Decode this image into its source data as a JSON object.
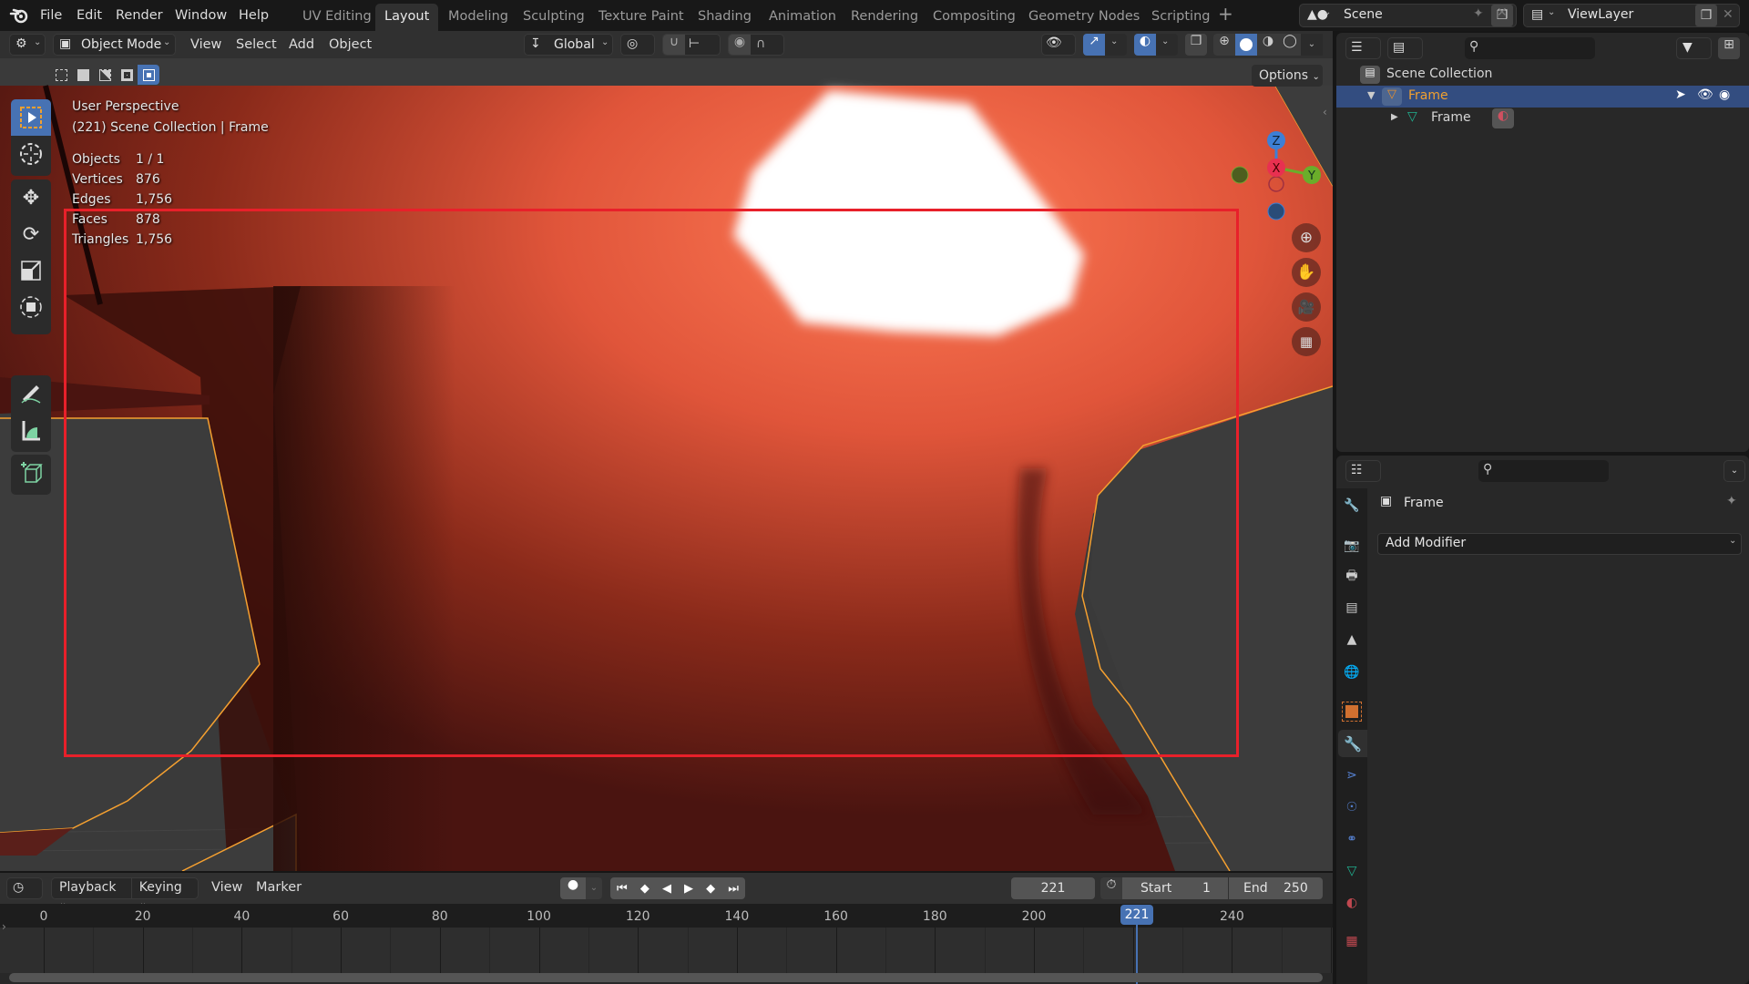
{
  "topbar": {
    "menus": [
      "File",
      "Edit",
      "Render",
      "Window",
      "Help"
    ],
    "workspaces": [
      "UV Editing",
      "Layout",
      "Modeling",
      "Sculpting",
      "Texture Paint",
      "Shading",
      "Animation",
      "Rendering",
      "Compositing",
      "Geometry Nodes",
      "Scripting"
    ],
    "active_workspace": "Layout",
    "add_workspace": "+",
    "scene": "Scene",
    "view_layer": "ViewLayer"
  },
  "viewport_header": {
    "mode": "Object Mode",
    "menus": [
      "View",
      "Select",
      "Add",
      "Object"
    ],
    "transform_orientation": "Global",
    "options_label": "Options"
  },
  "viewport": {
    "view_name": "User Perspective",
    "collection_info": "(221) Scene Collection | Frame",
    "stats": [
      {
        "label": "Objects",
        "value": "1 / 1"
      },
      {
        "label": "Vertices",
        "value": "876"
      },
      {
        "label": "Edges",
        "value": "1,756"
      },
      {
        "label": "Faces",
        "value": "878"
      },
      {
        "label": "Triangles",
        "value": "1,756"
      }
    ],
    "gizmo_axes": {
      "z": "Z",
      "x": "X",
      "y": "Y"
    },
    "colors": {
      "highlight_rect": "#e8202a",
      "selection_outline": "#f5a030",
      "object": "#c84a30"
    }
  },
  "outliner": {
    "root": "Scene Collection",
    "items": [
      {
        "name": "Frame",
        "type": "object",
        "selected": true
      },
      {
        "name": "Frame",
        "type": "mesh-data"
      }
    ]
  },
  "properties": {
    "object_name": "Frame",
    "add_modifier_label": "Add Modifier",
    "tabs": [
      "tool",
      "render",
      "output",
      "view-layer",
      "scene",
      "world",
      "object",
      "modifiers",
      "particles",
      "physics",
      "constraints",
      "data",
      "material",
      "texture"
    ],
    "active_tab": "modifiers"
  },
  "timeline": {
    "menus": [
      "Playback",
      "Keying",
      "View",
      "Marker"
    ],
    "current_frame": "221",
    "start_label": "Start",
    "start": "1",
    "end_label": "End",
    "end": "250",
    "ticks": [
      "0",
      "20",
      "40",
      "60",
      "80",
      "100",
      "120",
      "140",
      "160",
      "180",
      "200",
      "240"
    ],
    "playhead_label": "221"
  }
}
